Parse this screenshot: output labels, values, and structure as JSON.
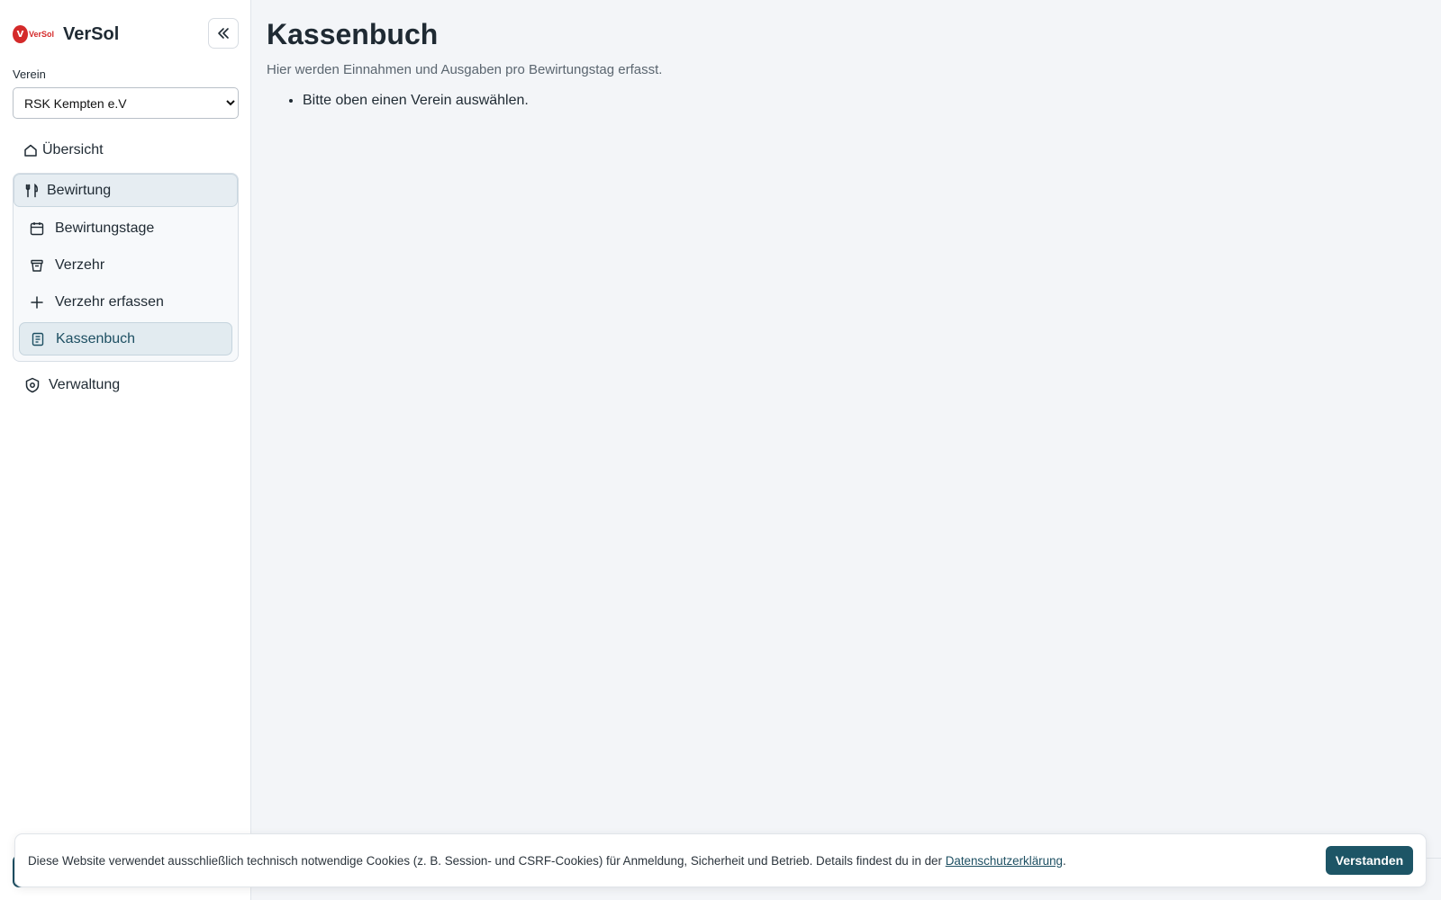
{
  "brand": {
    "logo_text": "VerSol",
    "name": "VerSol"
  },
  "sidebar": {
    "club_label": "Verein",
    "club_selected": "RSK Kempten e.V",
    "overview": "Übersicht",
    "group": {
      "label": "Bewirtung",
      "items": [
        {
          "label": "Bewirtungstage",
          "icon": "calendar-icon"
        },
        {
          "label": "Verzehr",
          "icon": "archive-icon"
        },
        {
          "label": "Verzehr erfassen",
          "icon": "plus-icon"
        },
        {
          "label": "Kassenbuch",
          "icon": "document-icon",
          "active": true
        }
      ]
    },
    "admin": "Verwaltung"
  },
  "main": {
    "title": "Kassenbuch",
    "subtitle": "Hier werden Einnahmen und Ausgaben pro Bewirtungstag erfasst.",
    "messages": [
      "Bitte oben einen Verein auswählen."
    ]
  },
  "cookie": {
    "text": "Diese Website verwendet ausschließlich technisch notwendige Cookies (z. B. Session- und CSRF-Cookies) für Anmeldung, Sicherheit und Betrieb. Details findest du in der ",
    "link": "Datenschutzerklärung",
    "suffix": ".",
    "button": "Verstanden"
  },
  "colors": {
    "accent": "#1d5566",
    "active_bg": "#e2ebf0",
    "logo_red": "#d42a2a"
  }
}
